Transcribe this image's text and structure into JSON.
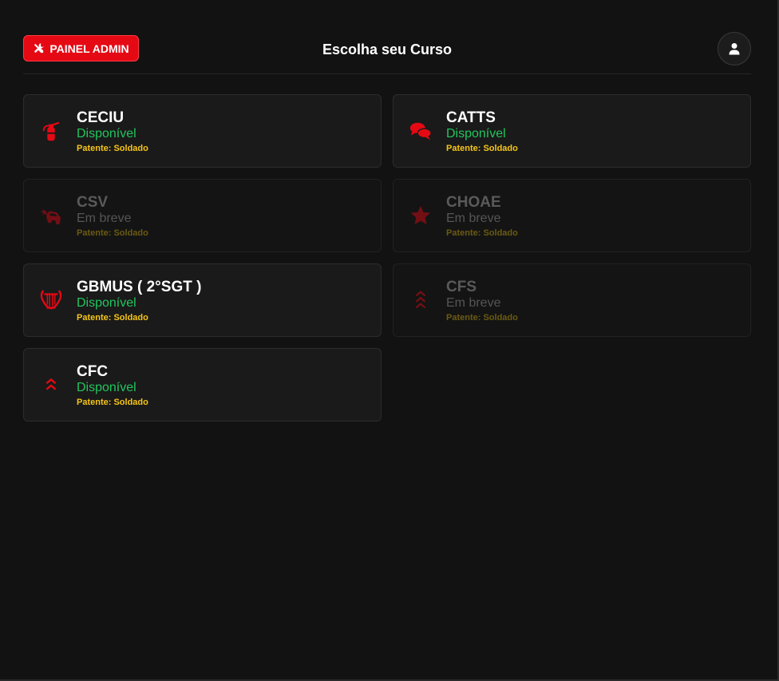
{
  "header": {
    "admin_label": "PAINEL ADMIN",
    "title": "Escolha seu Curso"
  },
  "rank_prefix": "Patente:",
  "courses": [
    {
      "name": "CECIU",
      "status": "Disponível",
      "rank": "Patente: Soldado",
      "icon": "fire-extinguisher-icon",
      "available": true
    },
    {
      "name": "CATTS",
      "status": "Disponível",
      "rank": "Patente: Soldado",
      "icon": "comments-icon",
      "available": true
    },
    {
      "name": "CSV",
      "status": "Em breve",
      "rank": "Patente: Soldado",
      "icon": "car-burst-icon",
      "available": false
    },
    {
      "name": "CHOAE",
      "status": "Em breve",
      "rank": "Patente: Soldado",
      "icon": "star-icon",
      "available": false
    },
    {
      "name": "GBMUS ( 2°SGT )",
      "status": "Disponível",
      "rank": "Patente: Soldado",
      "icon": "lyre-icon",
      "available": true
    },
    {
      "name": "CFS",
      "status": "Em breve",
      "rank": "Patente: Soldado",
      "icon": "triple-chevron-up-icon",
      "available": false
    },
    {
      "name": "CFC",
      "status": "Disponível",
      "rank": "Patente: Soldado",
      "icon": "double-chevron-up-icon",
      "available": true
    }
  ],
  "colors": {
    "accent": "#e50914",
    "available": "#22c55e",
    "rank": "#f5c518",
    "background": "#121212",
    "card": "#1a1a1a"
  }
}
